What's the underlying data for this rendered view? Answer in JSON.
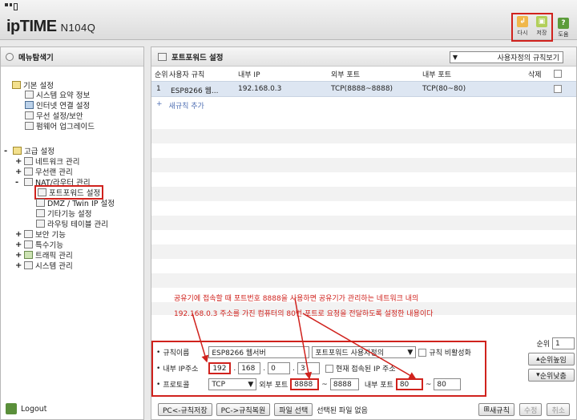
{
  "header": {
    "logo_main": "ipTIME",
    "logo_model": "N104Q",
    "buttons": [
      {
        "label": "다시",
        "color": "#f0b74a"
      },
      {
        "label": "저장",
        "color": "#b2cf5a"
      }
    ],
    "help_label": "도움",
    "help_color": "#5c9c3b"
  },
  "sidebar": {
    "title": "메뉴탐색기",
    "items": [
      {
        "label": "기본 설정",
        "icon": "settings-folder-icon"
      },
      {
        "label": "시스템 요약 정보",
        "icon": "chart-icon"
      },
      {
        "label": "인터넷 연결 설정",
        "icon": "globe-icon"
      },
      {
        "label": "무선 설정/보안",
        "icon": "wireless-icon"
      },
      {
        "label": "펌웨어 업그레이드",
        "icon": "firmware-icon"
      },
      {
        "label": "고급 설정",
        "icon": "settings-folder-icon"
      },
      {
        "label": "네트워크 관리",
        "icon": "network-icon"
      },
      {
        "label": "무선랜 관리",
        "icon": "wireless-icon"
      },
      {
        "label": "NAT/라우터 관리",
        "icon": "router-icon"
      },
      {
        "label": "포트포워드 설정",
        "icon": "page-icon"
      },
      {
        "label": "DMZ / Twin IP 설정",
        "icon": "page-icon"
      },
      {
        "label": "기타기능 설정",
        "icon": "page-icon"
      },
      {
        "label": "라우팅 테이블 관리",
        "icon": "page-icon"
      },
      {
        "label": "보안 기능",
        "icon": "security-icon"
      },
      {
        "label": "특수기능",
        "icon": "special-icon"
      },
      {
        "label": "트래픽 관리",
        "icon": "traffic-icon"
      },
      {
        "label": "시스템 관리",
        "icon": "system-icon"
      }
    ],
    "logout": "Logout"
  },
  "main": {
    "title": "포트포워드 설정",
    "view_select": "사용자정의 규칙보기",
    "columns": [
      "순위",
      "사용자 규칙",
      "내부 IP",
      "외부 포트",
      "내부 포트",
      "삭제"
    ],
    "rows": [
      {
        "rank": "1",
        "name": "ESP8266 웹...",
        "ip": "192.168.0.3",
        "ext_port": "TCP(8888~8888)",
        "int_port": "TCP(80~80)"
      }
    ],
    "add_rule": "새규칙 추가",
    "annotation_lines": [
      "공유기에 접속할 때 포트번호 8888을 사용하면 공유기가 관리하는 네트워크 내의",
      "192.168.0.3 주소를 가진 컴퓨터의 80번 포트로 요청을 전달하도록 설정한 내용이다"
    ]
  },
  "form": {
    "rule_name_label": "규칙이름",
    "rule_name_value": "ESP8266 웹서버",
    "rule_type_value": "포트포워드 사용자정의",
    "disable_label": "규칙 비활성화",
    "internal_ip_label": "내부 IP주소",
    "ip_parts": [
      "192",
      "168",
      "0",
      "3"
    ],
    "current_ip_label": "현재 접속된 IP 주소",
    "protocol_label": "프로토콜",
    "protocol_value": "TCP",
    "ext_port_label": "외부 포트",
    "ext_port_from": "8888",
    "ext_port_to": "8888",
    "int_port_label": "내부 포트",
    "int_port_from": "80",
    "int_port_to": "80",
    "tilde": "~"
  },
  "rank_control": {
    "label": "순위",
    "value": "1",
    "up_label": "순위높임",
    "down_label": "순위낮춤"
  },
  "footer": {
    "pc_save": "PC<-규칙저장",
    "pc_restore": "PC->규칙복원",
    "file_select": "파일 선택",
    "no_file": "선택된 파일 없음",
    "new_rule": "새규칙",
    "modify": "수정",
    "cancel": "취소"
  }
}
